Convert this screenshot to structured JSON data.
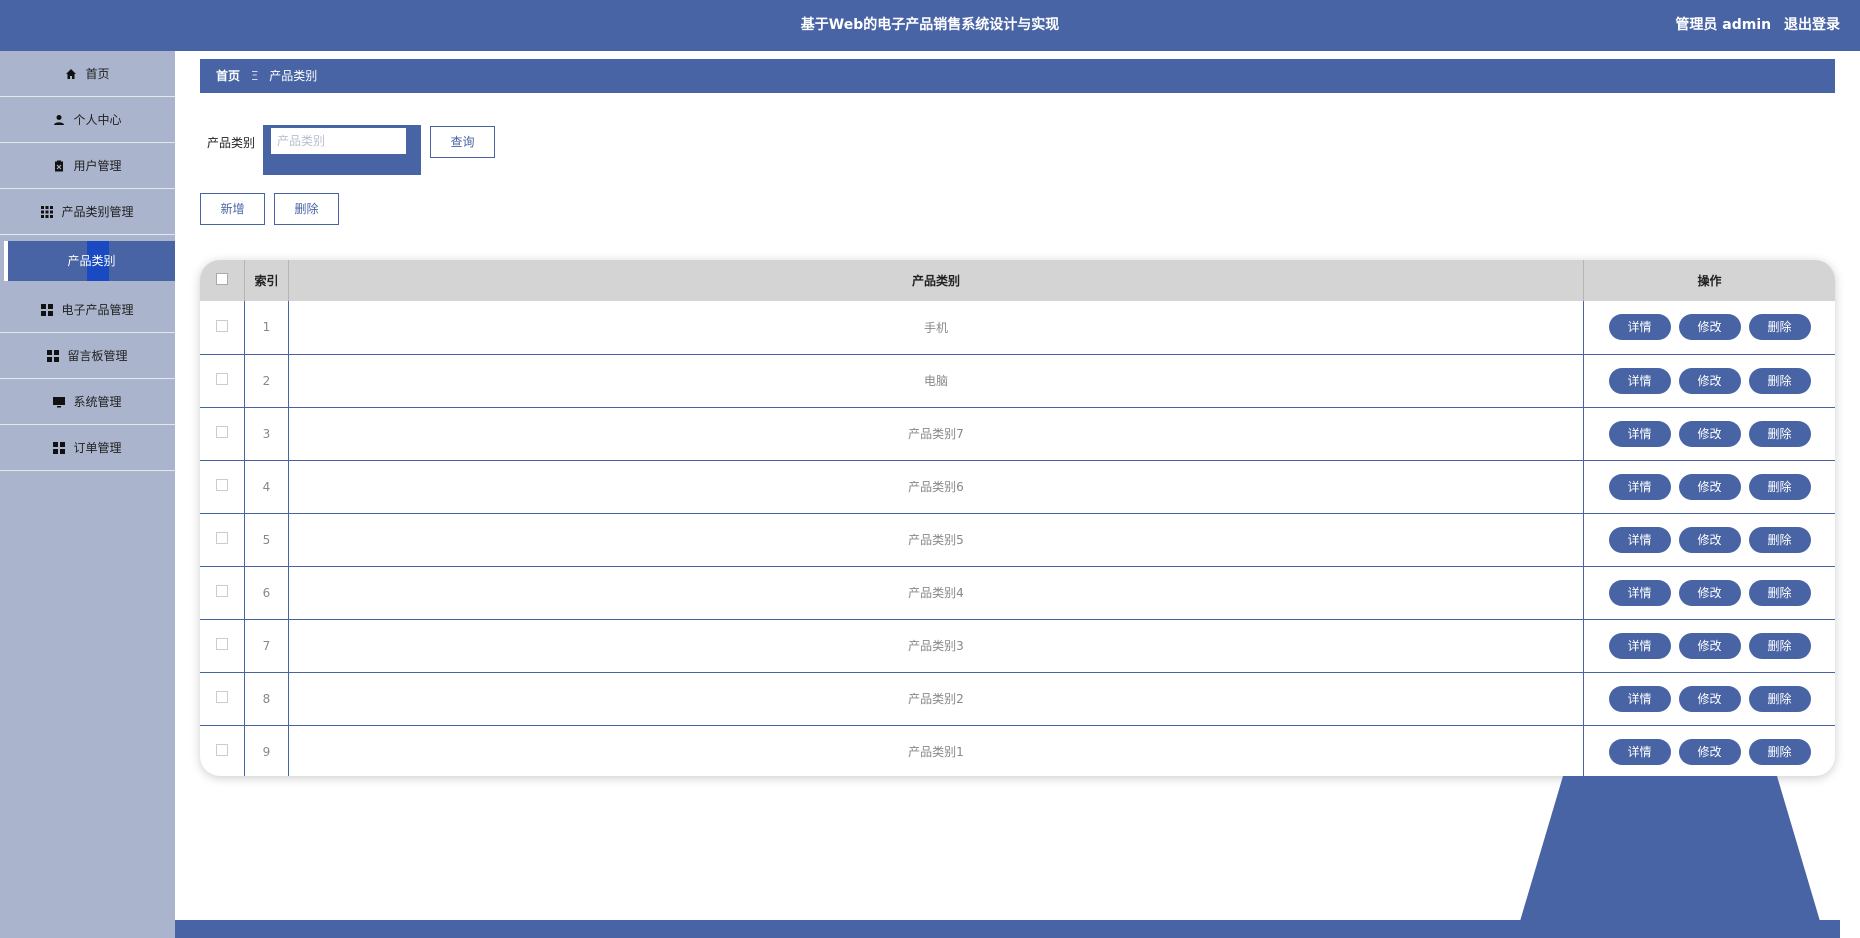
{
  "header": {
    "title": "基于Web的电子产品销售系统设计与实现",
    "user_label": "管理员 admin",
    "logout_label": "退出登录"
  },
  "sidebar": {
    "items": [
      {
        "label": "首页",
        "icon": "home-icon"
      },
      {
        "label": "个人中心",
        "icon": "user-icon"
      },
      {
        "label": "用户管理",
        "icon": "clipboard-icon"
      },
      {
        "label": "产品类别管理",
        "icon": "grid-icon"
      },
      {
        "label": "产品类别",
        "active": true
      },
      {
        "label": "电子产品管理",
        "icon": "apps-icon"
      },
      {
        "label": "留言板管理",
        "icon": "apps-icon"
      },
      {
        "label": "系统管理",
        "icon": "monitor-icon"
      },
      {
        "label": "订单管理",
        "icon": "apps-icon"
      }
    ]
  },
  "breadcrumb": {
    "home": "首页",
    "separator": "Ξ",
    "current": "产品类别"
  },
  "search": {
    "label": "产品类别",
    "placeholder": "产品类别",
    "button": "查询"
  },
  "actions": {
    "add": "新增",
    "delete": "删除"
  },
  "table": {
    "headers": {
      "index": "索引",
      "name": "产品类别",
      "ops": "操作"
    },
    "op_labels": {
      "detail": "详情",
      "edit": "修改",
      "delete": "删除"
    },
    "rows": [
      {
        "index": "1",
        "name": "手机"
      },
      {
        "index": "2",
        "name": "电脑"
      },
      {
        "index": "3",
        "name": "产品类别7"
      },
      {
        "index": "4",
        "name": "产品类别6"
      },
      {
        "index": "5",
        "name": "产品类别5"
      },
      {
        "index": "6",
        "name": "产品类别4"
      },
      {
        "index": "7",
        "name": "产品类别3"
      },
      {
        "index": "8",
        "name": "产品类别2"
      },
      {
        "index": "9",
        "name": "产品类别1"
      }
    ]
  },
  "colors": {
    "primary": "#4864a4",
    "sidebar": "#aab4cc",
    "header_row": "#d4d4d4"
  }
}
